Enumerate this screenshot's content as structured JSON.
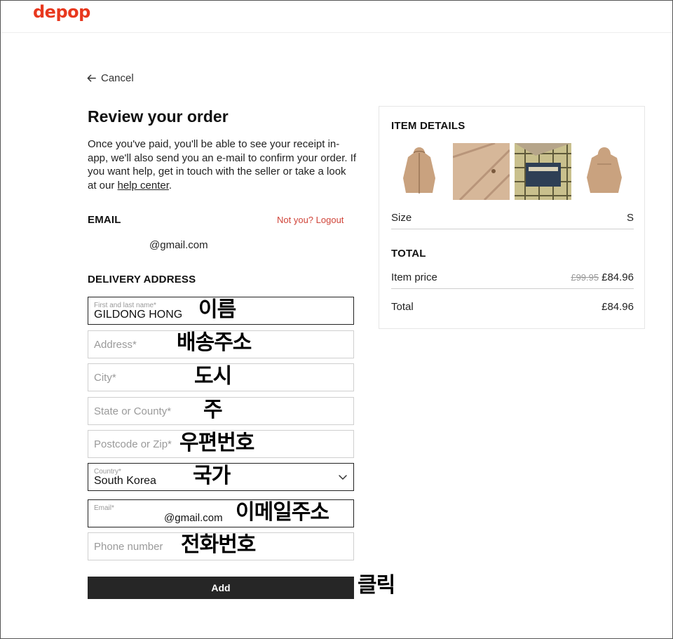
{
  "brand": {
    "logo_text": "depop",
    "color": "#e8381e"
  },
  "nav": {
    "cancel_label": "Cancel"
  },
  "page": {
    "title": "Review your order",
    "intro_text": "Once you've paid, you'll be able to see your receipt in-app, we'll also send you an e-mail to confirm your order. If you want help, get in touch with the seller or take a look at our ",
    "help_link": "help center",
    "intro_end": "."
  },
  "email_section": {
    "heading": "EMAIL",
    "logout_label": "Not you? Logout",
    "value": "@gmail.com"
  },
  "delivery": {
    "heading": "DELIVERY ADDRESS",
    "name": {
      "label": "First and last name*",
      "value": "GILDONG HONG"
    },
    "address": {
      "placeholder": "Address*"
    },
    "city": {
      "placeholder": "City*"
    },
    "state": {
      "placeholder": "State or County*"
    },
    "postcode": {
      "placeholder": "Postcode or Zip*"
    },
    "country": {
      "label": "Country*",
      "value": "South Korea"
    },
    "email": {
      "label": "Email*",
      "value": "@gmail.com"
    },
    "phone": {
      "placeholder": "Phone number"
    },
    "add_label": "Add"
  },
  "annotations": {
    "name": "이름",
    "address": "배송주소",
    "city": "도시",
    "state": "주",
    "postcode": "우편번호",
    "country": "국가",
    "email": "이메일주소",
    "phone": "전화번호",
    "click": "클릭"
  },
  "item_details": {
    "heading": "ITEM DETAILS",
    "size_label": "Size",
    "size_value": "S",
    "images": [
      {
        "icon": "jacket-front-photo"
      },
      {
        "icon": "jacket-closeup-photo"
      },
      {
        "icon": "jacket-lining-label-photo"
      },
      {
        "icon": "jacket-back-photo"
      }
    ]
  },
  "total": {
    "heading": "TOTAL",
    "item_price_label": "Item price",
    "original_price": "£99.95",
    "item_price": "£84.96",
    "total_label": "Total",
    "total_value": "£84.96"
  }
}
